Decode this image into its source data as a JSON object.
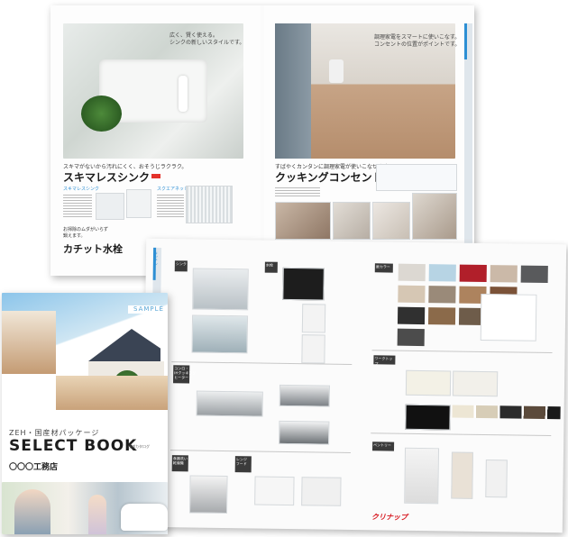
{
  "back_spread": {
    "left_page": {
      "headline_caption": "広く、賢く使える。\nシンクの新しいスタイルです。",
      "lead": "スキマがないから汚れにくく、おそうじラクラク。",
      "heading": "スキマレスシンク",
      "sub_left": "スキマレスシンク",
      "sub_right": "スクエアネット",
      "bottom_lead": "お掃除のムダがいらず\n鍋えます。",
      "bottom_heading": "カチット水栓"
    },
    "right_page": {
      "headline_caption": "調理家電をスマートに使いこなす。\nコンセントの位置がポイントです。",
      "lead": "すばやくカンタンに調理家電が使いこなせます。",
      "heading": "クッキングコンセント",
      "side_tab": "キッチン"
    }
  },
  "middle_spread": {
    "side_tab": "キッチン",
    "sections": [
      "シンク",
      "水栓",
      "コンロ・\nIHクッキング\nヒーター",
      "食器洗い\n乾燥機",
      "レンジ\nフード",
      "扉カラー",
      "ワークトップ",
      "ペントリー"
    ],
    "brand_logo": "クリナップ",
    "colors": {
      "swatches": [
        "#dcd8d2",
        "#b7d4e4",
        "#b11f2a",
        "#cbb9a8",
        "#595a5c",
        "#d6c7b4",
        "#9a8a79",
        "#ad835e",
        "#7b5238",
        "#303030",
        "#8b6a4a",
        "#6e5c4a",
        "#4c4c4c"
      ]
    }
  },
  "cover": {
    "sample_badge": "SAMPLE",
    "subtitle": "ZEH・国産材パッケージ",
    "title": "SELECT BOOK",
    "title_note": "仕様カタログ",
    "company": "〇〇〇工務店"
  }
}
